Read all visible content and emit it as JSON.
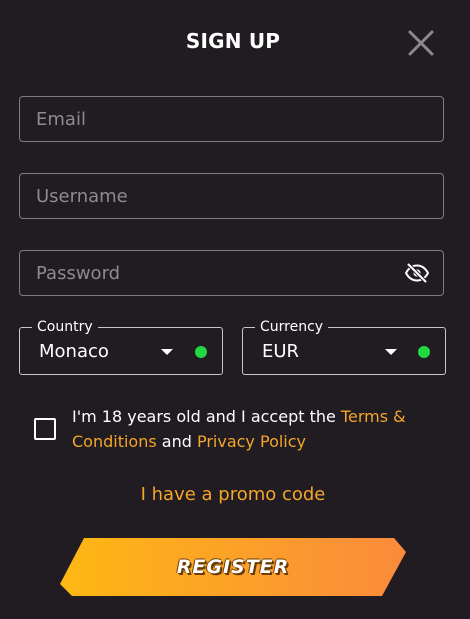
{
  "modal": {
    "title": "SIGN UP",
    "close_icon": "close-icon"
  },
  "fields": {
    "email": {
      "placeholder": "Email",
      "value": ""
    },
    "username": {
      "placeholder": "Username",
      "value": ""
    },
    "password": {
      "placeholder": "Password",
      "value": "",
      "toggle_icon": "eye-slash-icon"
    }
  },
  "country": {
    "label": "Country",
    "value": "Monaco",
    "status": "valid"
  },
  "currency": {
    "label": "Currency",
    "value": "EUR",
    "status": "valid"
  },
  "consent": {
    "checked": false,
    "text_prefix": "I'm 18 years old and I accept the ",
    "terms_link": "Terms & Conditions",
    "text_mid": " and ",
    "privacy_link": "Privacy Policy"
  },
  "promo": {
    "label": "I have a promo code"
  },
  "register": {
    "label": "REGISTER"
  },
  "colors": {
    "background": "#211c21",
    "accent": "#f4a52a",
    "valid_dot": "#1fd843",
    "button_gradient_start": "#fdb813",
    "button_gradient_end": "#fb8a3c"
  }
}
